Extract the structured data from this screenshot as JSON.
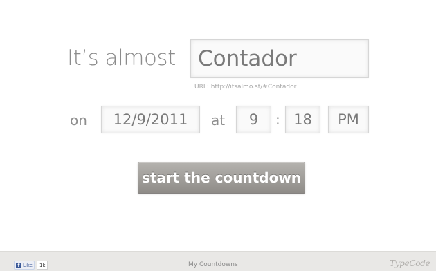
{
  "headline": "It’s almost",
  "event_name_value": "Contador",
  "url_hint": "URL: http://itsalmo.st/#Contador",
  "labels": {
    "on": "on",
    "at": "at",
    "colon": ":"
  },
  "date_value": "12/9/2011",
  "hour_value": "9",
  "minute_value": "18",
  "ampm_value": "PM",
  "start_button_label": "start the countdown",
  "footer": {
    "fb_icon": "f",
    "fb_like_label": "Like",
    "fb_like_count": "1k",
    "my_countdowns_label": "My Countdowns",
    "brand_logo_text": "TypeCode"
  }
}
